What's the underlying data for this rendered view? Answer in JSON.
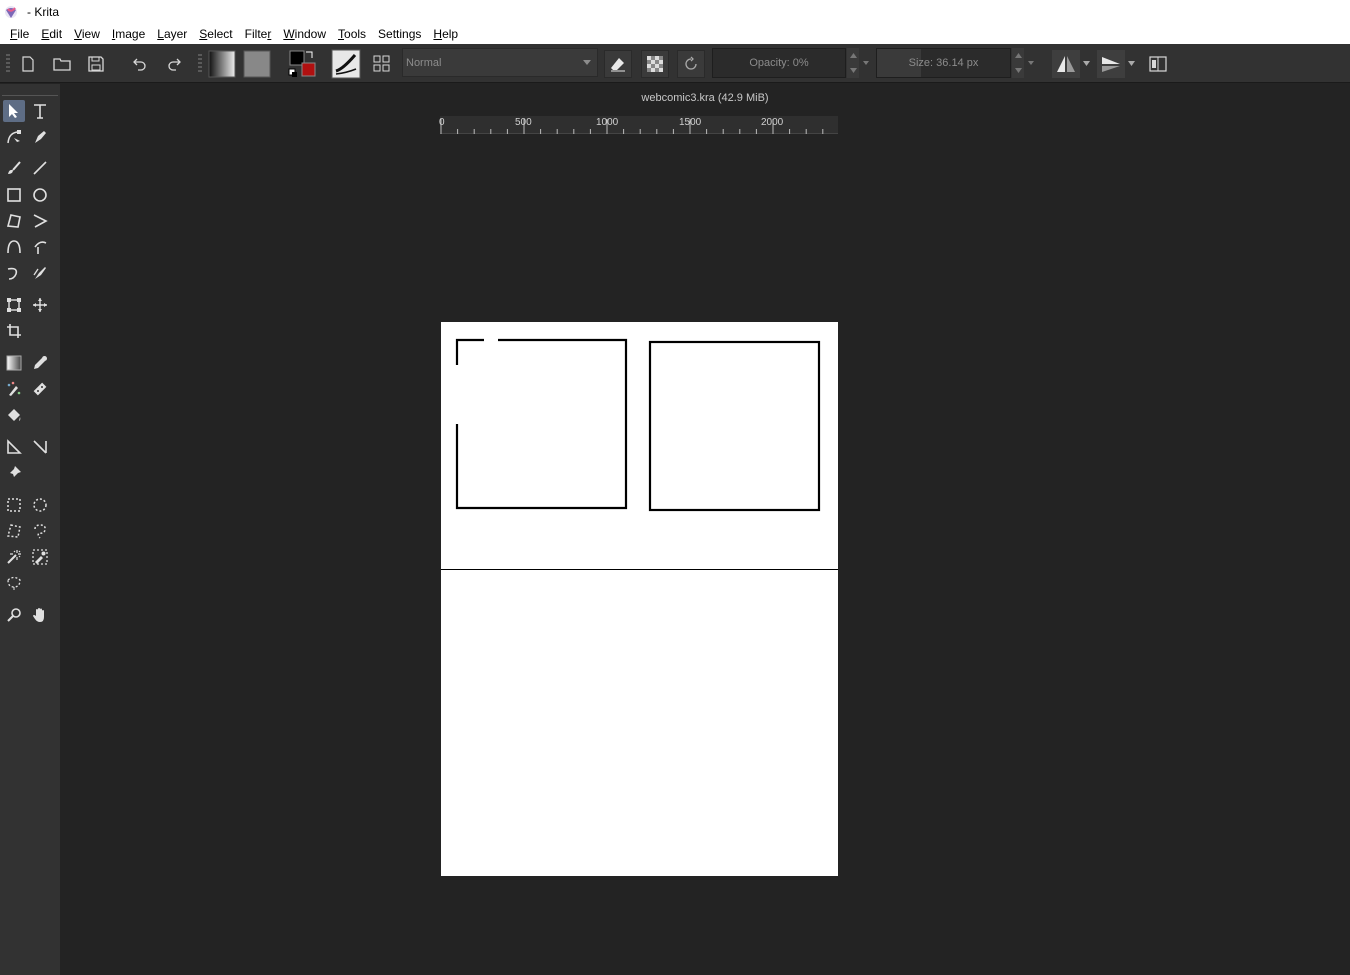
{
  "window": {
    "title": "- Krita"
  },
  "menu": [
    {
      "mnemonic": "F",
      "rest": "ile"
    },
    {
      "mnemonic": "E",
      "rest": "dit"
    },
    {
      "mnemonic": "V",
      "rest": "iew"
    },
    {
      "mnemonic": "I",
      "rest": "mage"
    },
    {
      "mnemonic": "L",
      "rest": "ayer"
    },
    {
      "mnemonic": "S",
      "rest": "elect"
    },
    {
      "mnemonic": "",
      "rest": "Filte",
      "tail_mn": "r"
    },
    {
      "mnemonic": "W",
      "rest": "indow"
    },
    {
      "mnemonic": "T",
      "rest": "ools"
    },
    {
      "mnemonic": "",
      "rest": "Settin",
      "tail_mn": "g",
      "tail": "s"
    },
    {
      "mnemonic": "H",
      "rest": "elp"
    }
  ],
  "toolbar": {
    "blend_mode": "Normal",
    "opacity_label": "Opacity: 0%",
    "size_label": "Size: 36.14 px"
  },
  "document": {
    "title": "webcomic3.kra (42.9 MiB)"
  },
  "ruler": {
    "labels": [
      "0",
      "500",
      "1000",
      "1500",
      "2000"
    ]
  },
  "colors": {
    "foreground": "#000000",
    "background": "#b01010"
  }
}
